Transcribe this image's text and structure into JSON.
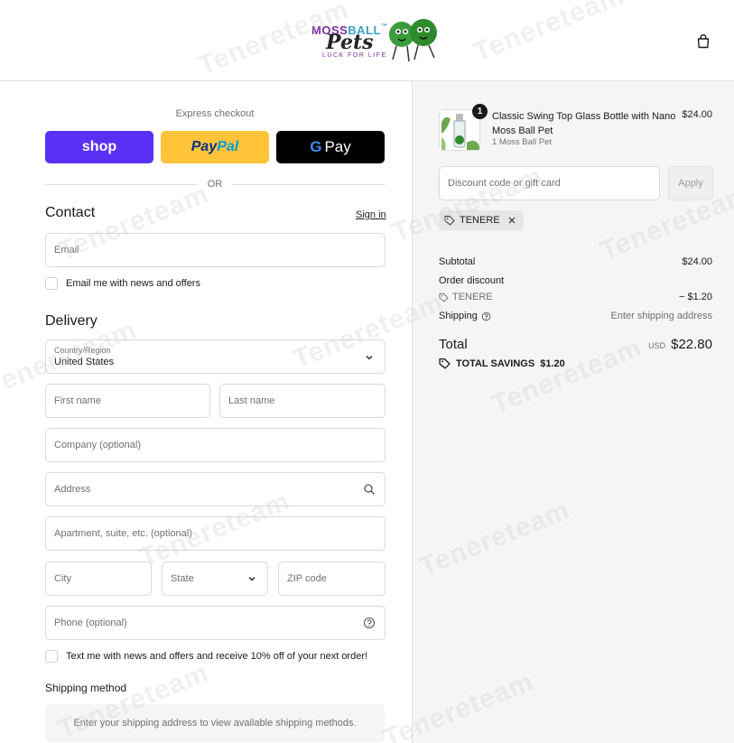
{
  "header": {
    "logo": {
      "word1": "MOSS",
      "word2": "BALL",
      "tm": "™",
      "word3": "Pets",
      "tagline": "LUCK FOR LIFE"
    }
  },
  "express": {
    "label": "Express checkout",
    "shop_label": "shop",
    "paypal_label_1": "Pay",
    "paypal_label_2": "Pal",
    "gpay_g": "G",
    "gpay_label": "Pay",
    "or_label": "OR"
  },
  "contact": {
    "title": "Contact",
    "signin_label": "Sign in",
    "email_placeholder": "Email",
    "newsletter_label": "Email me with news and offers"
  },
  "delivery": {
    "title": "Delivery",
    "country_label": "Country/Region",
    "country_value": "United States",
    "first_name_placeholder": "First name",
    "last_name_placeholder": "Last name",
    "company_placeholder": "Company (optional)",
    "address_placeholder": "Address",
    "apartment_placeholder": "Apartment, suite, etc. (optional)",
    "city_placeholder": "City",
    "state_placeholder": "State",
    "zip_placeholder": "ZIP code",
    "phone_placeholder": "Phone (optional)",
    "sms_label": "Text me with news and offers and receive 10% off of your next order!"
  },
  "shipping_method": {
    "title": "Shipping method",
    "message": "Enter your shipping address to view available shipping methods."
  },
  "order": {
    "product": {
      "quantity": "1",
      "name": "Classic Swing Top Glass Bottle with Nano Moss Ball Pet",
      "variant": "1 Moss Ball Pet",
      "price": "$24.00"
    },
    "discount_placeholder": "Discount code or gift card",
    "apply_label": "Apply",
    "applied_code": "TENERE",
    "subtotal_label": "Subtotal",
    "subtotal_value": "$24.00",
    "order_discount_label": "Order discount",
    "discount_code": "TENERE",
    "discount_value": "− $1.20",
    "shipping_label": "Shipping",
    "shipping_value": "Enter shipping address",
    "total_label": "Total",
    "total_currency": "USD",
    "total_value": "$22.80",
    "savings_label": "TOTAL SAVINGS",
    "savings_value": "$1.20"
  },
  "watermark": "Tenereteam",
  "colors": {
    "shop": "#5a31f4",
    "paypal": "#ffc439",
    "gpay": "#000000",
    "summary_bg": "#f5f5f5"
  }
}
